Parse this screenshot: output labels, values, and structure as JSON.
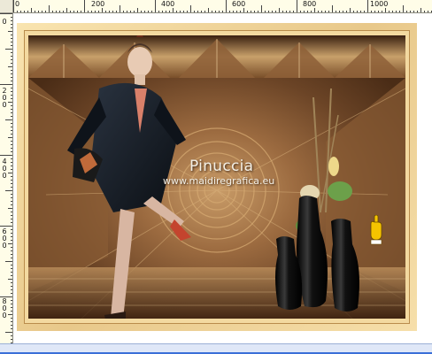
{
  "ruler": {
    "horizontal_labels": [
      "0",
      "200",
      "400",
      "600",
      "800",
      "1000"
    ],
    "vertical_labels": [
      "0",
      "200",
      "400",
      "600",
      "800"
    ]
  },
  "canvas": {
    "watermark_title": "Pinuccia",
    "watermark_url": "www.maidiregrafica.eu"
  },
  "colors": {
    "frame": "#f3d9a0",
    "background_brown": "#6e4a2c",
    "ruler_bg": "#fffde8",
    "scrollbar": "#3a6fd8"
  },
  "icons": {
    "pointer": "pointing-hand-icon"
  }
}
